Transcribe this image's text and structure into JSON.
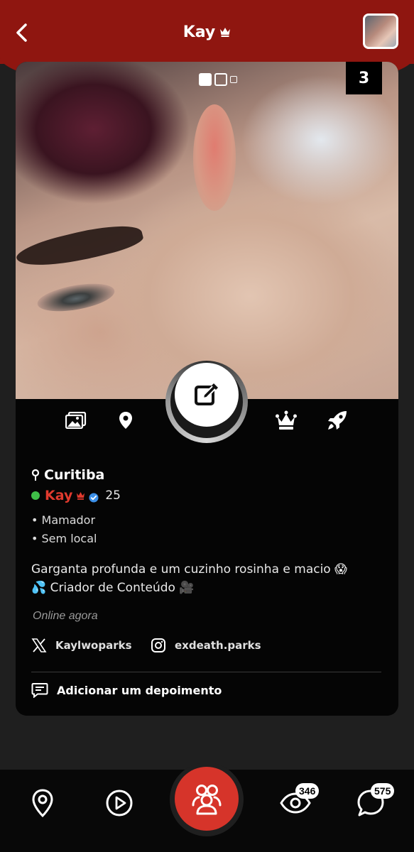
{
  "header": {
    "title": "Kay",
    "title_icon": "crown-icon",
    "back_icon": "chevron-left-icon",
    "brand_color": "#8f1610"
  },
  "photo": {
    "counter": "3",
    "pager": [
      "active",
      "inactive",
      "inactive-small"
    ]
  },
  "action_bar": {
    "icons": [
      "gallery-icon",
      "location-pin-icon",
      "edit-icon",
      "crown-icon",
      "rocket-icon"
    ]
  },
  "profile": {
    "city": "Curitiba",
    "name": "Kay",
    "age": "25",
    "online_color": "#3fbf48",
    "name_color": "#e03a2e",
    "verified_color": "#3b8fe8",
    "tags": [
      "• Mamador",
      "• Sem local"
    ],
    "bio_line1": "Garganta profunda e um cuzinho rosinha e macio 😱",
    "bio_line2": "💦 Criador de Conteúdo 🎥",
    "status": "Online agora",
    "twitter": "Kaylwoparks",
    "instagram": "exdeath.parks",
    "testimonial_label": "Adicionar um depoimento"
  },
  "bottom_nav": {
    "items": [
      "map-pin-icon",
      "play-icon",
      "people-icon",
      "eye-icon",
      "chat-icon"
    ],
    "views_badge": "346",
    "chat_badge": "575",
    "center_color": "#d6342a"
  }
}
